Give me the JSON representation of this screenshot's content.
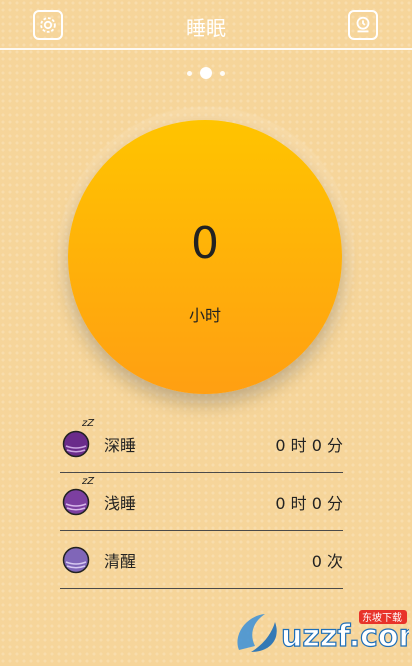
{
  "header": {
    "title": "睡眠",
    "left_icon": "gear-icon",
    "right_icon": "alarm-clock-icon"
  },
  "pager": {
    "count": 3,
    "active_index": 1
  },
  "sleep_total": {
    "value": "0",
    "unit": "小时"
  },
  "stats": [
    {
      "label": "深睡",
      "value": "0 时 0 分",
      "icon": "deep-sleep-ball-icon",
      "color": "#6a2b8a"
    },
    {
      "label": "浅睡",
      "value": "0 时 0 分",
      "icon": "light-sleep-ball-icon",
      "color": "#7c3fa0"
    },
    {
      "label": "清醒",
      "value": "0 次",
      "icon": "awake-ball-icon",
      "color": "#8066b8"
    }
  ],
  "watermark": {
    "text": "uzzf.com",
    "subtext": "东坡下载"
  }
}
